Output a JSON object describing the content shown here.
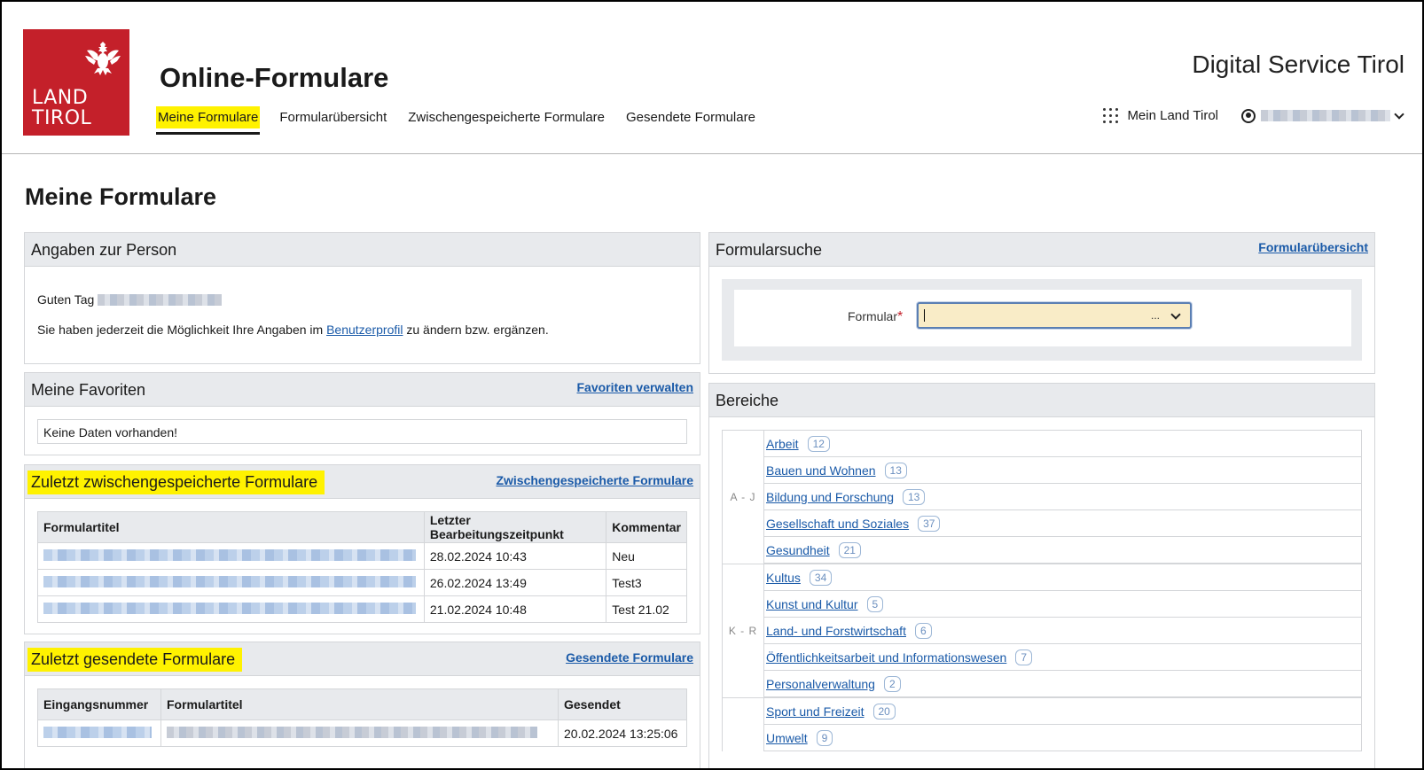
{
  "header": {
    "logo_line1": "LAND",
    "logo_line2": "TIROL",
    "app_title": "Online-Formulare",
    "brand": "Digital Service Tirol",
    "nav": [
      {
        "label": "Meine Formulare",
        "active": true
      },
      {
        "label": "Formularübersicht",
        "active": false
      },
      {
        "label": "Zwischengespeicherte Formulare",
        "active": false
      },
      {
        "label": "Gesendete Formulare",
        "active": false
      }
    ],
    "mein_land": "Mein Land Tirol"
  },
  "page_title": "Meine Formulare",
  "person": {
    "title": "Angaben zur Person",
    "greeting": "Guten Tag",
    "info_prefix": "Sie haben jederzeit die Möglichkeit Ihre Angaben im",
    "info_link": "Benutzerprofil",
    "info_suffix": "zu ändern bzw. ergänzen."
  },
  "favorites": {
    "title": "Meine Favoriten",
    "link": "Favoriten verwalten",
    "empty": "Keine Daten vorhanden!"
  },
  "saved": {
    "title": "Zuletzt zwischengespeicherte Formulare",
    "link": "Zwischengespeicherte Formulare",
    "columns": [
      "Formulartitel",
      "Letzter Bearbeitungszeitpunkt",
      "Kommentar"
    ],
    "rows": [
      {
        "time": "28.02.2024 10:43",
        "comment": "Neu"
      },
      {
        "time": "26.02.2024 13:49",
        "comment": "Test3"
      },
      {
        "time": "21.02.2024 10:48",
        "comment": "Test 21.02"
      }
    ]
  },
  "sent": {
    "title": "Zuletzt gesendete Formulare",
    "link": "Gesendete Formulare",
    "columns": [
      "Eingangsnummer",
      "Formulartitel",
      "Gesendet"
    ],
    "rows": [
      {
        "sent": "20.02.2024 13:25:06"
      }
    ]
  },
  "search": {
    "title": "Formularsuche",
    "link": "Formularübersicht",
    "label": "Formular",
    "required_mark": "*",
    "ellipsis": "..."
  },
  "areas": {
    "title": "Bereiche",
    "groups": [
      {
        "label": "A - J",
        "items": [
          {
            "name": "Arbeit",
            "count": "12"
          },
          {
            "name": "Bauen und Wohnen",
            "count": "13"
          },
          {
            "name": "Bildung und Forschung",
            "count": "13"
          },
          {
            "name": "Gesellschaft und Soziales",
            "count": "37"
          },
          {
            "name": "Gesundheit",
            "count": "21"
          }
        ]
      },
      {
        "label": "K - R",
        "items": [
          {
            "name": "Kultus",
            "count": "34"
          },
          {
            "name": "Kunst und Kultur",
            "count": "5"
          },
          {
            "name": "Land- und Forstwirtschaft",
            "count": "6"
          },
          {
            "name": "Öffentlichkeitsarbeit und Informationswesen",
            "count": "7"
          },
          {
            "name": "Personalverwaltung",
            "count": "2"
          }
        ]
      },
      {
        "label": "",
        "items": [
          {
            "name": "Sport und Freizeit",
            "count": "20"
          },
          {
            "name": "Umwelt",
            "count": "9"
          }
        ]
      }
    ]
  },
  "colors": {
    "brand_red": "#c4202a",
    "highlight": "#fff200",
    "link": "#1a5aa8"
  }
}
